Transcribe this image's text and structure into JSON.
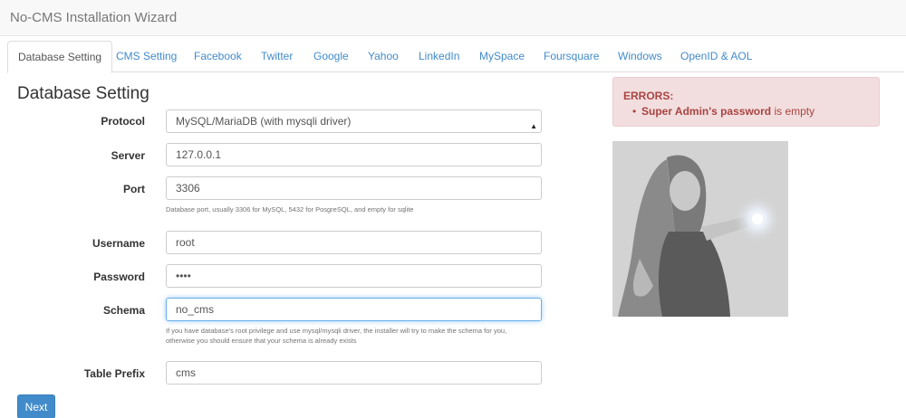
{
  "app": {
    "title": "No-CMS Installation Wizard"
  },
  "tabs": [
    {
      "label": "Database Setting",
      "active": true
    },
    {
      "label": "CMS Setting"
    },
    {
      "label": "Facebook"
    },
    {
      "label": "Twitter"
    },
    {
      "label": "Google"
    },
    {
      "label": "Yahoo"
    },
    {
      "label": "LinkedIn"
    },
    {
      "label": "MySpace"
    },
    {
      "label": "Foursquare"
    },
    {
      "label": "Windows"
    },
    {
      "label": "OpenID & AOL"
    }
  ],
  "form": {
    "title": "Database Setting",
    "protocol": {
      "label": "Protocol",
      "value": "MySQL/MariaDB (with mysqli driver)"
    },
    "server": {
      "label": "Server",
      "value": "127.0.0.1"
    },
    "port": {
      "label": "Port",
      "value": "3306",
      "help": "Database port, usually 3306 for MySQL, 5432 for PosgreSQL, and empty for sqlite"
    },
    "username": {
      "label": "Username",
      "value": "root"
    },
    "password": {
      "label": "Password",
      "value": "••••"
    },
    "schema": {
      "label": "Schema",
      "value": "no_cms",
      "help_line1": "If you have database's root privilege and use mysql/mysqli driver, the installer will try to make the schema for you,",
      "help_line2": "otherwise you should ensure that your schema is already exists"
    },
    "table_prefix": {
      "label": "Table Prefix",
      "value": "cms"
    }
  },
  "buttons": {
    "next": "Next"
  },
  "errors": {
    "title": "ERRORS:",
    "item_bold": "Super Admin's password",
    "item_rest": " is empty"
  },
  "colors": {
    "accent": "#428bca",
    "error_text": "#a94442",
    "error_bg": "#f2dede"
  }
}
